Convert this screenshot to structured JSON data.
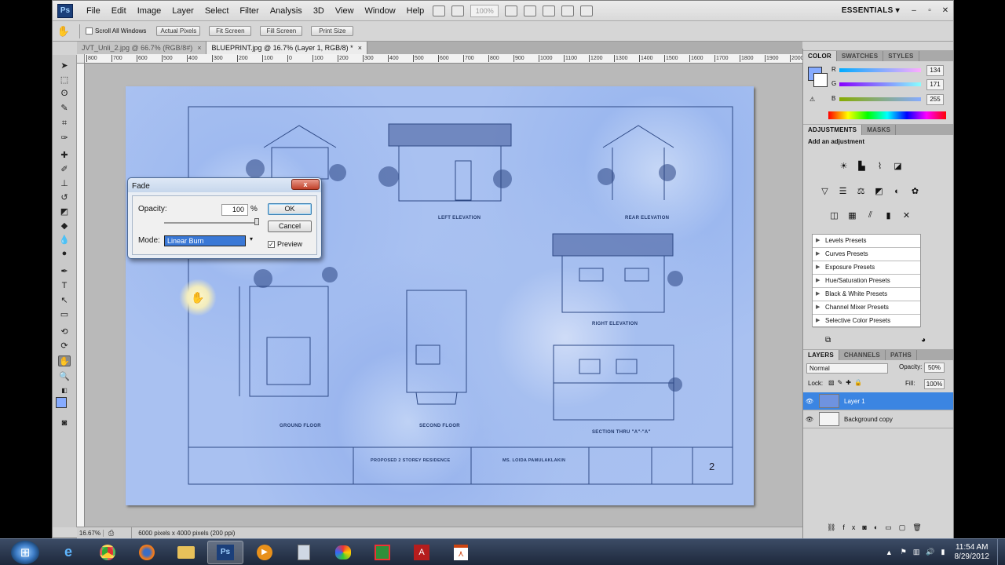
{
  "menubar": {
    "logo": "Ps",
    "items": [
      "File",
      "Edit",
      "Image",
      "Layer",
      "Select",
      "Filter",
      "Analysis",
      "3D",
      "View",
      "Window",
      "Help"
    ],
    "zoom": "100%",
    "workspace": "ESSENTIALS ▾"
  },
  "options": {
    "scroll_all_windows": "Scroll All Windows",
    "actual_pixels": "Actual Pixels",
    "fit_screen": "Fit Screen",
    "fill_screen": "Fill Screen",
    "print_size": "Print Size"
  },
  "tabs": [
    {
      "label": "JVT_Unli_2.jpg @ 66.7% (RGB/8#)"
    },
    {
      "label": "BLUEPRINT.jpg @ 16.7% (Layer 1, RGB/8) *"
    }
  ],
  "ruler_ticks": [
    "800",
    "700",
    "600",
    "500",
    "400",
    "300",
    "200",
    "100",
    "0",
    "100",
    "200",
    "300",
    "400",
    "500",
    "600",
    "700",
    "800",
    "900",
    "1000",
    "1100",
    "1200",
    "1300",
    "1400",
    "1500",
    "1600",
    "1700",
    "1800",
    "1900",
    "2000"
  ],
  "canvas": {
    "labels": {
      "left_elevation": "LEFT ELEVATION",
      "rear_elevation": "REAR ELEVATION",
      "right_elevation": "RIGHT ELEVATION",
      "ground_floor": "GROUND FLOOR",
      "second_floor": "SECOND FLOOR",
      "section": "SECTION THRU \"A\"-\"A\"",
      "project": "PROPOSED 2 STOREY RESIDENCE",
      "owner": "MS. LOIDA PAMULAKLAKIN"
    },
    "sheet_number": "2"
  },
  "dialog": {
    "title": "Fade",
    "close": "x",
    "opacity_label": "Opacity:",
    "opacity_value": "100",
    "percent": "%",
    "mode_label": "Mode:",
    "mode_value": "Linear Burn",
    "ok": "OK",
    "cancel": "Cancel",
    "preview": "Preview"
  },
  "status": {
    "zoom": "16.67%",
    "info": "6000 pixels x 4000 pixels (200 ppi)"
  },
  "color_panel": {
    "tabs": [
      "COLOR",
      "SWATCHES",
      "STYLES"
    ],
    "r_label": "R",
    "r": "134",
    "g_label": "G",
    "g": "171",
    "b_label": "B",
    "b": "255",
    "foreground": "#86abff"
  },
  "adjustments_panel": {
    "tabs": [
      "ADJUSTMENTS",
      "MASKS"
    ],
    "heading": "Add an adjustment",
    "presets": [
      "Levels Presets",
      "Curves Presets",
      "Exposure Presets",
      "Hue/Saturation Presets",
      "Black & White Presets",
      "Channel Mixer Presets",
      "Selective Color Presets"
    ]
  },
  "layers_panel": {
    "tabs": [
      "LAYERS",
      "CHANNELS",
      "PATHS"
    ],
    "blend_mode": "Normal",
    "opacity_label": "Opacity:",
    "opacity": "50%",
    "lock_label": "Lock:",
    "fill_label": "Fill:",
    "fill": "100%",
    "layers": [
      {
        "name": "Layer 1",
        "selected": true
      },
      {
        "name": "Background copy",
        "selected": false
      }
    ]
  },
  "taskbar": {
    "time": "11:54 AM",
    "date": "8/29/2012"
  }
}
